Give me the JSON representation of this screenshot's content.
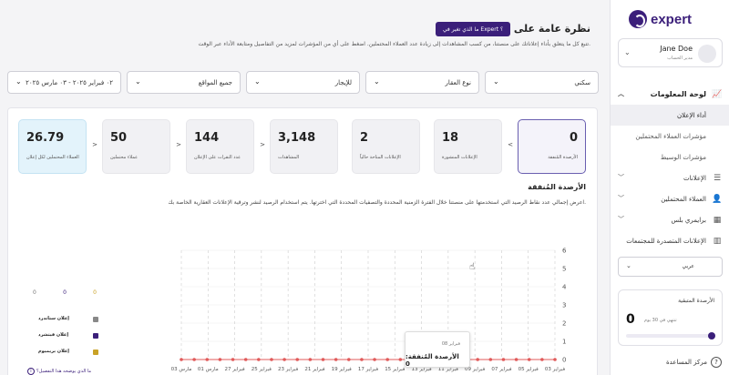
{
  "brand": {
    "name": "expert",
    "primary_color": "#3b1f7a"
  },
  "user": {
    "name": "Jane Doe",
    "role": "مدير الحساب"
  },
  "sidebar": {
    "dashboard_label": "لوحة المعلومات",
    "items": [
      {
        "label": "أداء الإعلان"
      },
      {
        "label": "مؤشرات العملاء المحتملين"
      },
      {
        "label": "مؤشرات الوسيط"
      },
      {
        "label": "الإعلانات"
      },
      {
        "label": "العملاء المحتملين"
      },
      {
        "label": "برايمري بلس"
      },
      {
        "label": "الإعلانات المتصدرة للمجتمعات"
      }
    ],
    "language": "عربي",
    "credits": {
      "title": "الأرصدة المتبقية",
      "value": "0",
      "note": "تنتهي في 30 يوم",
      "progress": 0
    },
    "help": "مركز المساعدة"
  },
  "header": {
    "title": "نظرة عامة على الأداء",
    "whats_new": "ما الذي تغير في Expert ؟",
    "description": "تتبع كل ما يتعلق بأداء إعلاناتك على منصتنا، من كسب المشاهدات إلى زيادة عدد العملاء المحتملين. اضغط على أي من المؤشرات لمزيد من التفاصيل ومتابعة الأداء عبر الوقت."
  },
  "filters": [
    {
      "label": "سكني"
    },
    {
      "label": "نوع العقار"
    },
    {
      "label": "للإيجار"
    },
    {
      "label": "جميع المواقع"
    },
    {
      "label": "٠٢ فبراير ٢٠٢٥ - ٠٣ مارس ٢٠٢٥"
    }
  ],
  "kpis": [
    {
      "value": "0",
      "label": "الأرصدة المُنفقة"
    },
    {
      "value": "18",
      "label": "الإعلانات المنشورة"
    },
    {
      "value": "2",
      "label": "الإعلانات المتاحة حالياً"
    },
    {
      "value": "3,148",
      "label": "المشاهدات"
    },
    {
      "value": "144",
      "label": "عدد النقرات على الإعلان"
    },
    {
      "value": "50",
      "label": "عملاء محتملين"
    },
    {
      "value": "26.79",
      "label": "العملاء المحتملين لكل إعلان"
    }
  ],
  "section": {
    "title": "الأرصدة المُنفقة",
    "description": "اعرض إجمالي عدد نقاط الرصيد التي استخدمتها على منصتنا خلال الفترة الزمنية المحددة والتصفيات المحددة التي اخترتها. يتم استخدام الرصيد لنشر وترقية الإعلانات العقارية الخاصة بك."
  },
  "chart_data": {
    "type": "line",
    "x_tick_labels": [
      "03 مارس",
      "01 مارس",
      "27 فبراير",
      "25 فبراير",
      "23 فبراير",
      "21 فبراير",
      "19 فبراير",
      "17 فبراير",
      "15 فبراير",
      "13 فبراير",
      "11 فبراير",
      "09 فبراير",
      "07 فبراير",
      "05 فبراير",
      "03 فبراير"
    ],
    "ylim": [
      0,
      6
    ],
    "y_ticks": [
      0,
      1,
      2,
      3,
      4,
      5,
      6
    ],
    "series": [
      {
        "color": "#e05a5a",
        "values": [
          0,
          0,
          0,
          0,
          0,
          0,
          0,
          0,
          0,
          0,
          0,
          0,
          0,
          0,
          0,
          0,
          0,
          0,
          0,
          0,
          0,
          0,
          0,
          0,
          0,
          0,
          0,
          0,
          0,
          0
        ]
      }
    ]
  },
  "tooltip": {
    "date": "فبراير 08",
    "text": "الأرصدة المُنفقة: 0"
  },
  "legend": {
    "counts": [
      "0",
      "0",
      "0"
    ],
    "count_colors": [
      "#777777",
      "#3b1f7a",
      "#c9a227"
    ],
    "items": [
      {
        "label": "إعلان ستاندرد",
        "color": "#888888"
      },
      {
        "label": "إعلان فيتشرد",
        "color": "#3b1f7a"
      },
      {
        "label": "إعلان بريميوم",
        "color": "#c9a227"
      }
    ],
    "help": "ما الذي يوضحه هذا التفصيل؟"
  }
}
